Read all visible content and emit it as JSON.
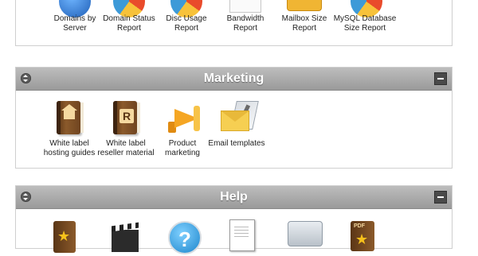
{
  "top_section": {
    "items": [
      {
        "label_line1": "Domains by",
        "label_line2": "Server",
        "icon": "globe-server-icon"
      },
      {
        "label_line1": "Domain Status",
        "label_line2": "Report",
        "icon": "domain-status-pie-icon"
      },
      {
        "label_line1": "Disc Usage",
        "label_line2": "Report",
        "icon": "disc-usage-pie-icon"
      },
      {
        "label_line1": "Bandwidth",
        "label_line2": "Report",
        "icon": "bandwidth-graph-icon"
      },
      {
        "label_line1": "Mailbox Size",
        "label_line2": "Report",
        "icon": "mailbox-icon"
      },
      {
        "label_line1": "MySQL Database",
        "label_line2": "Size Report",
        "icon": "database-pie-icon"
      }
    ]
  },
  "marketing": {
    "title": "Marketing",
    "items": [
      {
        "label_line1": "White label",
        "label_line2": "hosting guides",
        "icon": "house-book-icon"
      },
      {
        "label_line1": "White label",
        "label_line2": "reseller material",
        "icon": "reseller-book-icon"
      },
      {
        "label_line1": "Product",
        "label_line2": "marketing",
        "icon": "megaphone-icon"
      },
      {
        "label_line1": "Email templates",
        "label_line2": "",
        "icon": "email-template-icon"
      }
    ]
  },
  "help": {
    "title": "Help",
    "items": [
      {
        "icon": "star-book-icon"
      },
      {
        "icon": "video-clapper-icon"
      },
      {
        "icon": "help-question-icon"
      },
      {
        "icon": "document-pen-icon"
      },
      {
        "icon": "server-icon"
      },
      {
        "icon": "pdf-book-icon"
      }
    ]
  },
  "colors": {
    "header_bg": "#a9a9a9",
    "header_text": "#ffffff",
    "panel_border": "#cfcfcf",
    "accent_orange": "#f5a623"
  }
}
